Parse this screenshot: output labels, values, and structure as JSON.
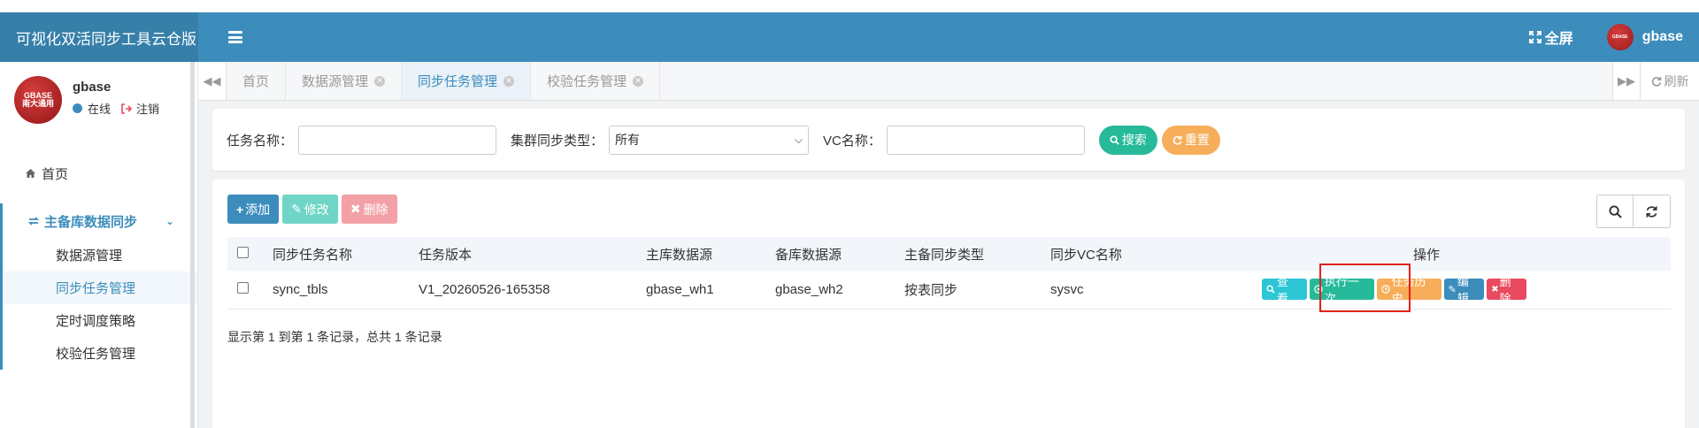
{
  "app": {
    "title": "可视化双活同步工具云仓版"
  },
  "header": {
    "fullscreen_label": "全屏",
    "username": "gbase",
    "logo_text": "GBASE"
  },
  "sidebar": {
    "logo_line1": "GBASE",
    "logo_line2": "南大通用",
    "user": {
      "name": "gbase",
      "status": "在线",
      "logout": "注销"
    },
    "home": "首页",
    "group": {
      "label": "主备库数据同步",
      "items": [
        {
          "label": "数据源管理"
        },
        {
          "label": "同步任务管理"
        },
        {
          "label": "定时调度策略"
        },
        {
          "label": "校验任务管理"
        }
      ]
    }
  },
  "tabs": {
    "items": [
      {
        "label": "首页"
      },
      {
        "label": "数据源管理"
      },
      {
        "label": "同步任务管理"
      },
      {
        "label": "校验任务管理"
      }
    ],
    "refresh_label": "刷新"
  },
  "filter": {
    "task_name_label": "任务名称：",
    "task_name_value": "",
    "sync_type_label": "集群同步类型：",
    "sync_type_value": "所有",
    "vc_label": "VC名称：",
    "vc_value": "",
    "search_label": "搜索",
    "reset_label": "重置"
  },
  "toolbar": {
    "add": "添加",
    "edit": "修改",
    "delete": "删除"
  },
  "table": {
    "columns": [
      "同步任务名称",
      "任务版本",
      "主库数据源",
      "备库数据源",
      "主备同步类型",
      "同步VC名称",
      "操作"
    ],
    "rows": [
      {
        "task_name": "sync_tbls",
        "version": "V1_20260526-165358",
        "primary": "gbase_wh1",
        "standby": "gbase_wh2",
        "sync_type": "按表同步",
        "vc": "sysvc"
      }
    ],
    "actions": {
      "view": "查 看",
      "run_once": "执行一次",
      "history": "任务历史",
      "edit": "编辑",
      "delete": "删除"
    }
  },
  "pagination": {
    "summary": "显示第 1 到第 1 条记录，总共 1 条记录"
  },
  "colors": {
    "header": "#3c8dbc",
    "brand": "#367fa9",
    "green": "#26b99a",
    "orange": "#f7ae5b",
    "blue": "#3c8dbc",
    "teal_light": "#6fd5c6",
    "red_light": "#f3a1a6",
    "cyan": "#2cc6d5",
    "red": "#e84a5f",
    "highlight": "#e0201a"
  }
}
